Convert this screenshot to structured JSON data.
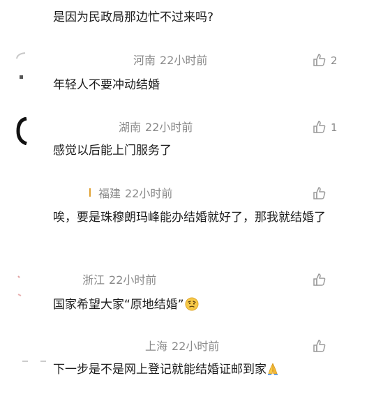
{
  "comments": [
    {
      "text": "是因为民政局那边忙不过来吗?"
    },
    {
      "location": "河南",
      "time": "22小时前",
      "text": "年轻人不要冲动结婚",
      "like_count": "2"
    },
    {
      "location": "湖南",
      "time": "22小时前",
      "text": "感觉以后能上门服务了",
      "like_count": "1"
    },
    {
      "location": "福建",
      "time": "22小时前",
      "text": "唉，要是珠穆朗玛峰能办结婚就好了，那我就结婚了",
      "like_count": ""
    },
    {
      "location": "浙江",
      "time": "22小时前",
      "text": "国家希望大家“原地结婚”"
    },
    {
      "location": "上海",
      "time": "22小时前",
      "text": "下一步是不是网上登记就能结婚证邮到家"
    }
  ],
  "icons": {
    "like": "thumbs-up-icon",
    "face_emoji": "thinking-face-emoji",
    "pray_emoji": "praying-hands-emoji"
  },
  "colors": {
    "meta_text": "#8a8a8a",
    "body_text": "#1c1c1c",
    "icon_stroke": "#9a9a9a",
    "emoji_yellow": "#f7c948"
  }
}
